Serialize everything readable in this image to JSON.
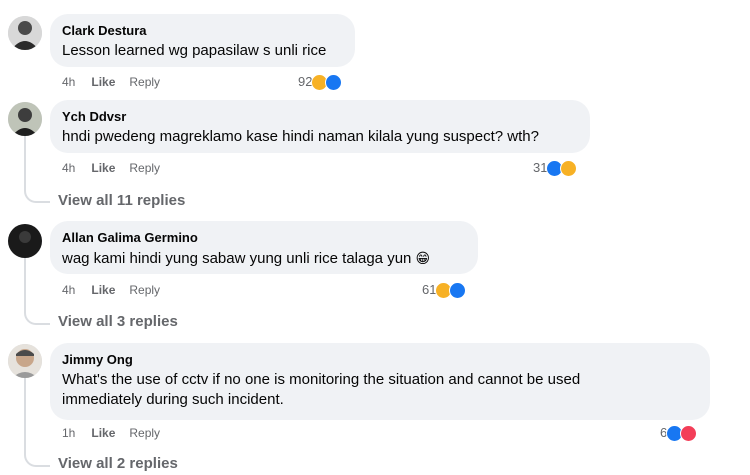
{
  "comments": [
    {
      "author": "Clark Destura",
      "text": "Lesson learned wg papasilaw s unli rice",
      "time": "4h",
      "like": "Like",
      "reply": "Reply",
      "reaction_count": "92",
      "reactions": [
        "haha-icon",
        "like-icon"
      ]
    },
    {
      "author": "Ych Ddvsr",
      "text": "hndi pwedeng magreklamo kase hindi naman kilala yung suspect? wth?",
      "time": "4h",
      "like": "Like",
      "reply": "Reply",
      "reaction_count": "31",
      "reactions": [
        "like-icon",
        "haha-icon"
      ],
      "view_replies": "View all 11 replies"
    },
    {
      "author": "Allan Galima Germino",
      "text": "wag kami hindi yung sabaw yung unli rice talaga yun",
      "emoji": "😁",
      "time": "4h",
      "like": "Like",
      "reply": "Reply",
      "reaction_count": "61",
      "reactions": [
        "haha-icon",
        "like-icon"
      ],
      "view_replies": "View all 3 replies"
    },
    {
      "author": "Jimmy Ong",
      "text_line1": "What's the use of cctv if no one is monitoring the situation and cannot be used",
      "text_line2": "immediately during such incident.",
      "time": "1h",
      "like": "Like",
      "reply": "Reply",
      "reaction_count": "6",
      "reactions": [
        "like-icon",
        "love-icon"
      ],
      "view_replies": "View all 2 replies"
    }
  ],
  "colors": {
    "bubble": "#f0f2f5",
    "meta": "#65676b",
    "like": "#1877f2",
    "haha": "#f7b125",
    "love": "#f33e58"
  }
}
